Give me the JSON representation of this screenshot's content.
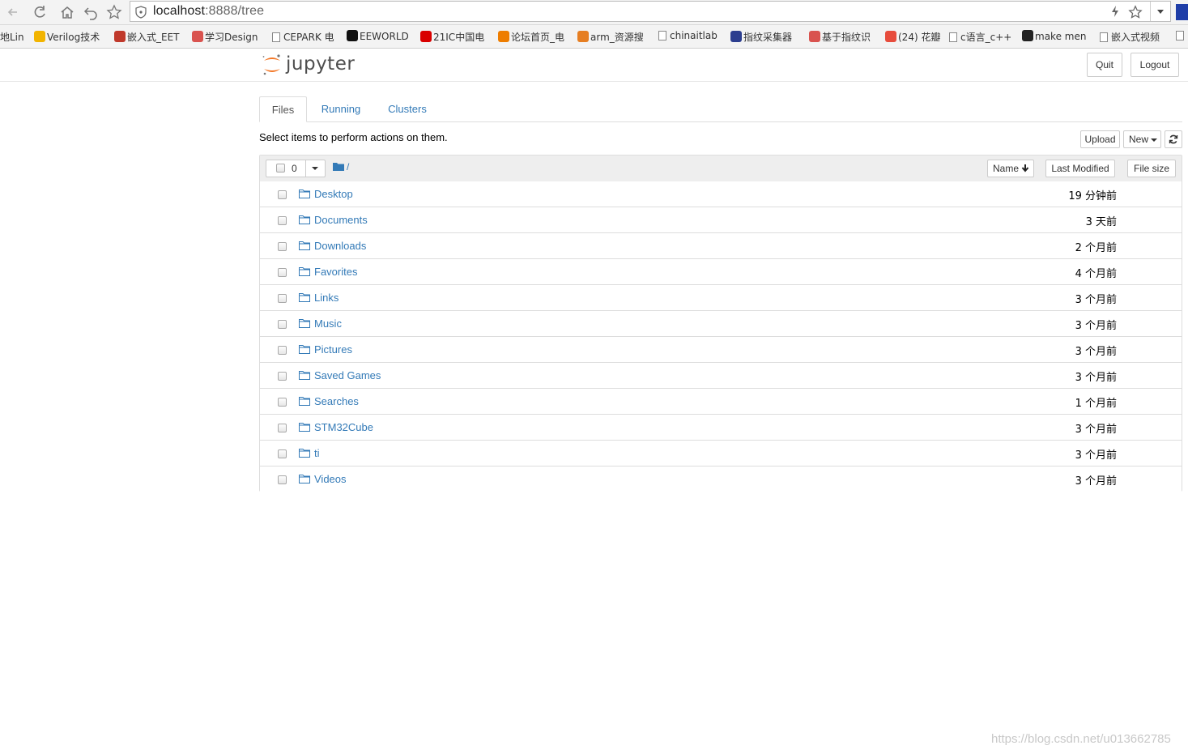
{
  "browser": {
    "url_host": "localhost",
    "url_rest": ":8888/tree",
    "bookmarks": [
      {
        "label": "地Lin",
        "icon": "none",
        "color": "#333333"
      },
      {
        "label": "Verilog技术",
        "icon": "yellow-bulb-icon",
        "color": "#f2b400"
      },
      {
        "label": "嵌入式_EET",
        "icon": "red-badge-icon",
        "color": "#c0392b"
      },
      {
        "label": "学习Design",
        "icon": "red-knot-icon",
        "color": "#d9534f"
      },
      {
        "label": "CEPARK 电",
        "icon": "page-icon",
        "color": "#888888"
      },
      {
        "label": "EEWORLD",
        "icon": "black-c-icon",
        "color": "#111111"
      },
      {
        "label": "21IC中国电",
        "icon": "red-21-icon",
        "color": "#d90000"
      },
      {
        "label": "论坛首页_电",
        "icon": "orange-box-icon",
        "color": "#ee7d00"
      },
      {
        "label": "arm_资源搜",
        "icon": "fox-icon",
        "color": "#e67e22"
      },
      {
        "label": "chinaitlab",
        "icon": "page-icon",
        "color": "#888888"
      },
      {
        "label": "指纹采集器",
        "icon": "blue-red-icon",
        "color": "#2c3e8f"
      },
      {
        "label": "基于指纹识",
        "icon": "red-knot-icon",
        "color": "#d9534f"
      },
      {
        "label": "(24) 花瓣",
        "icon": "red-flower-icon",
        "color": "#e74c3c"
      },
      {
        "label": "c语言_c++",
        "icon": "page-icon",
        "color": "#888888"
      },
      {
        "label": "make men",
        "icon": "penguin-icon",
        "color": "#222222"
      },
      {
        "label": "嵌入式视频",
        "icon": "page-icon",
        "color": "#888888"
      }
    ]
  },
  "header": {
    "logo_text": "jupyter",
    "quit_label": "Quit",
    "logout_label": "Logout"
  },
  "tabs": [
    {
      "label": "Files",
      "active": true
    },
    {
      "label": "Running",
      "active": false
    },
    {
      "label": "Clusters",
      "active": false
    }
  ],
  "toolbar": {
    "hint": "Select items to perform actions on them.",
    "upload_label": "Upload",
    "new_label": "New"
  },
  "list_header": {
    "selected_count": "0",
    "breadcrumb": "/",
    "name_label": "Name",
    "last_modified_label": "Last Modified",
    "file_size_label": "File size"
  },
  "files": [
    {
      "name": "Desktop",
      "modified": "19 分钟前"
    },
    {
      "name": "Documents",
      "modified": "3 天前"
    },
    {
      "name": "Downloads",
      "modified": "2 个月前"
    },
    {
      "name": "Favorites",
      "modified": "4 个月前"
    },
    {
      "name": "Links",
      "modified": "3 个月前"
    },
    {
      "name": "Music",
      "modified": "3 个月前"
    },
    {
      "name": "Pictures",
      "modified": "3 个月前"
    },
    {
      "name": "Saved Games",
      "modified": "3 个月前"
    },
    {
      "name": "Searches",
      "modified": "1 个月前"
    },
    {
      "name": "STM32Cube",
      "modified": "3 个月前"
    },
    {
      "name": "ti",
      "modified": "3 个月前"
    },
    {
      "name": "Videos",
      "modified": "3 个月前"
    }
  ],
  "watermark": "https://blog.csdn.net/u013662785",
  "colors": {
    "link": "#337ab7",
    "jupyter_orange": "#f37726",
    "border": "#dddddd"
  }
}
